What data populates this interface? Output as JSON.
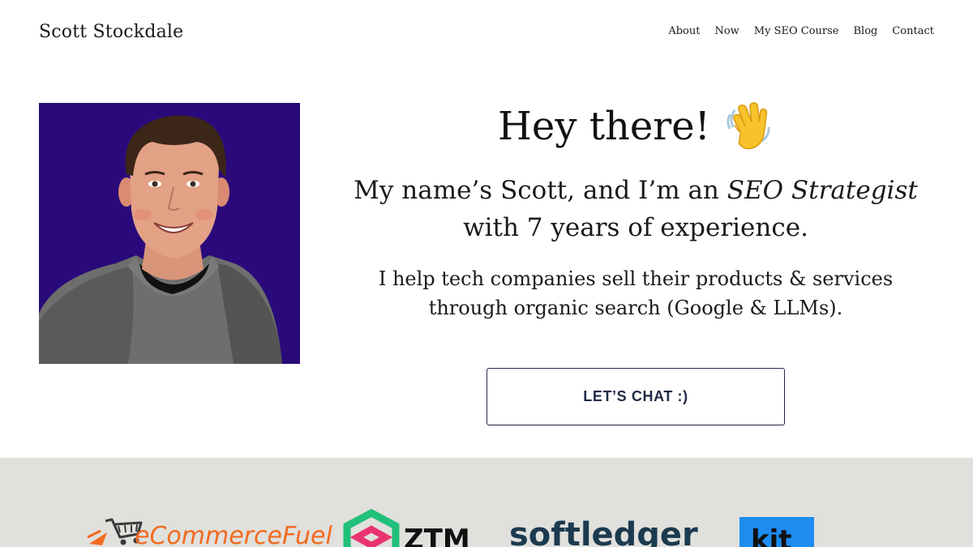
{
  "header": {
    "site_title": "Scott Stockdale",
    "nav": [
      "About",
      "Now",
      "My SEO Course",
      "Blog",
      "Contact"
    ]
  },
  "hero": {
    "title": "Hey there!",
    "title_icon": "waving-hand-icon",
    "intro_before": "My name’s Scott, and I’m an ",
    "intro_emphasis": "SEO Strategist",
    "intro_after": " with 7 years of experience.",
    "subheading": "I help tech companies sell their products & services through organic search (Google & LLMs).",
    "cta_label": "LET’S CHAT :)"
  },
  "logos": {
    "ecommercefuel": {
      "text": "eCommerceFuel",
      "icon": "shopping-cart-icon"
    },
    "ztm": {
      "text": "ZTM",
      "icon": "ztm-hexagon-icon"
    },
    "softledger": {
      "text": "softledger"
    },
    "kit": {
      "text": "kit"
    }
  },
  "colors": {
    "photo_background": "#2a0a7a",
    "cta_border": "#1f2a44",
    "logo_band": "#e0e0dc",
    "ecommercefuel_orange": "#f26a21",
    "ztm_green": "#21c07a",
    "ztm_pink": "#e8336f",
    "softledger_navy": "#1c3a4f",
    "kit_blue": "#1e8cf0"
  }
}
